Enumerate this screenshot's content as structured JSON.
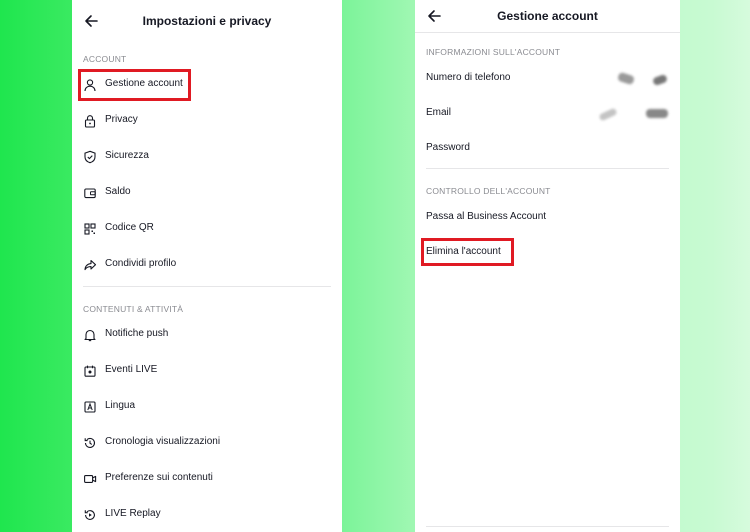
{
  "left_screen": {
    "title": "Impostazioni e privacy",
    "section_account": "ACCOUNT",
    "account_items": [
      {
        "label": "Gestione account",
        "icon": "person-icon"
      },
      {
        "label": "Privacy",
        "icon": "lock-icon"
      },
      {
        "label": "Sicurezza",
        "icon": "shield-icon"
      },
      {
        "label": "Saldo",
        "icon": "wallet-icon"
      },
      {
        "label": "Codice QR",
        "icon": "qr-code-icon"
      },
      {
        "label": "Condividi profilo",
        "icon": "share-icon"
      }
    ],
    "section_content": "CONTENUTI & ATTIVITÀ",
    "content_items": [
      {
        "label": "Notifiche push",
        "icon": "bell-icon"
      },
      {
        "label": "Eventi LIVE",
        "icon": "calendar-icon"
      },
      {
        "label": "Lingua",
        "icon": "language-icon"
      },
      {
        "label": "Cronologia visualizzazioni",
        "icon": "history-icon"
      },
      {
        "label": "Preferenze sui contenuti",
        "icon": "video-icon"
      },
      {
        "label": "LIVE Replay",
        "icon": "replay-icon"
      }
    ]
  },
  "right_screen": {
    "title": "Gestione account",
    "section_info": "INFORMAZIONI SULL'ACCOUNT",
    "info_items": [
      "Numero di telefono",
      "Email",
      "Password"
    ],
    "section_control": "CONTROLLO DELL'ACCOUNT",
    "control_items": [
      "Passa al Business Account",
      "Elimina l'account"
    ]
  },
  "colors": {
    "highlight": "#e01a23",
    "background_green": "#1fe64e",
    "section_text": "#8a8b91"
  }
}
